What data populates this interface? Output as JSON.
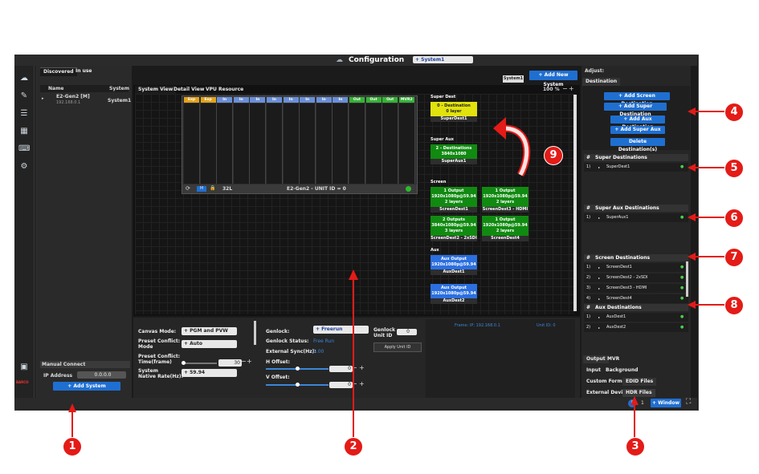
{
  "title": {
    "text": "Configuration",
    "system_select": "+ System1"
  },
  "left_panel": {
    "tabs": [
      "Discovered",
      "In use"
    ],
    "columns": {
      "name": "Name",
      "system": "System"
    },
    "device": {
      "name": "E2-Gen2 [M]",
      "ip": "192.168.0.1",
      "system": "System1"
    },
    "manual_connect": {
      "title": "Manual Connect",
      "ip_label": "IP Address",
      "ip_value": "0.0.0.0",
      "add_button": "+ Add System"
    },
    "brand": "BARCO"
  },
  "center": {
    "tabs": [
      "System View",
      "Detail View",
      "VPU Resource"
    ],
    "system_badge": "System1",
    "add_new_system": "+ Add New System",
    "zoom": "100 %",
    "slot_labels": [
      "Exp",
      "Exp",
      "In",
      "In",
      "In",
      "In",
      "In",
      "In",
      "In",
      "In",
      "Out",
      "Out",
      "Out",
      "MVR2"
    ],
    "frame_footer": {
      "number": "32L",
      "unit": "E2-Gen2 - UNIT ID = 0",
      "m": "M"
    },
    "dest_groups": {
      "super_dest": {
        "title": "Super Dest",
        "items": [
          {
            "line1": "0 - Destination",
            "line2": "0 layer",
            "label": "SuperDest1"
          }
        ]
      },
      "super_aux": {
        "title": "Super Aux",
        "items": [
          {
            "line1": "2 - Destinations",
            "line2": "3840x1080",
            "label": "SuperAux1"
          }
        ]
      },
      "screen": {
        "title": "Screen",
        "items": [
          {
            "line1": "1 Output",
            "line2": "1920x1080p@59.94",
            "line3": "2 layers",
            "label": "ScreenDest1"
          },
          {
            "line1": "1 Output",
            "line2": "1920x1080p@59.94",
            "line3": "2 layers",
            "label": "ScreenDest3 - HDMI"
          },
          {
            "line1": "2 Outputs",
            "line2": "3840x1080p@59.94",
            "line3": "3 layers",
            "label": "ScreenDest2 - 2xSDI"
          },
          {
            "line1": "1 Output",
            "line2": "1920x1080p@59.94",
            "line3": "2 layers",
            "label": "ScreenDest4"
          }
        ]
      },
      "aux": {
        "title": "Aux",
        "items": [
          {
            "line1": "Aux Output",
            "line2": "1920x1080p@59.94",
            "label": "AuxDest1"
          },
          {
            "line1": "Aux Output",
            "line2": "1920x1080p@59.94",
            "label": "AuxDest2"
          }
        ]
      }
    }
  },
  "properties": {
    "canvas_mode": {
      "label": "Canvas Mode:",
      "value": "+ PGM and PVW"
    },
    "preset_conflict_mode": {
      "label1": "Preset Conflict:",
      "label2": "Mode",
      "value": "+ Auto"
    },
    "preset_conflict_time": {
      "label1": "Preset Conflict:",
      "label2": "Time(frame)",
      "value": "30"
    },
    "native_rate": {
      "label1": "System",
      "label2": "Native Rate(Hz):",
      "value": "+ 59.94"
    },
    "genlock": {
      "label": "Genlock:",
      "value": "+ Freerun"
    },
    "genlock_unit": {
      "label1": "Genlock",
      "label2": "Unit ID",
      "value": "0"
    },
    "genlock_status": {
      "label": "Genlock Status:",
      "value": "Free Run"
    },
    "external_sync": {
      "label": "External Sync(Hz):",
      "value": "0.00"
    },
    "apply_unit": "Apply Unit ID",
    "h_offset": {
      "label": "H Offset:",
      "value": "0"
    },
    "v_offset": {
      "label": "V Offset:",
      "value": "0"
    },
    "frame_info": {
      "ip": "Frame: IP: 192.168.0.1",
      "unit": "Unit ID: 0"
    }
  },
  "right_panel": {
    "adjust_label": "Adjust:",
    "destination_tab": "Destination",
    "buttons": [
      "+ Add Screen Destination",
      "+ Add Super Destination",
      "+ Add Aux Destination",
      "+ Add Super Aux",
      "Delete Destination(s)"
    ],
    "super_destinations": {
      "title": "Super Destinations",
      "items": [
        {
          "n": "1)",
          "name": "SuperDest1"
        }
      ]
    },
    "super_aux_destinations": {
      "title": "Super Aux Destinations",
      "items": [
        {
          "n": "1)",
          "name": "SuperAux1"
        }
      ]
    },
    "screen_destinations": {
      "title": "Screen Destinations",
      "items": [
        {
          "n": "1)",
          "name": "ScreenDest1"
        },
        {
          "n": "2)",
          "name": "ScreenDest2 - 2xSDI"
        },
        {
          "n": "3)",
          "name": "ScreenDest3 - HDMI"
        },
        {
          "n": "4)",
          "name": "ScreenDest4"
        }
      ]
    },
    "aux_destinations": {
      "title": "Aux Destinations",
      "items": [
        {
          "n": "1)",
          "name": "AuxDest1"
        },
        {
          "n": "2)",
          "name": "AuxDest2"
        }
      ]
    },
    "bottom_tabs": {
      "row1": [
        "Output",
        "MVR"
      ],
      "row2": [
        "Input",
        "Background"
      ],
      "row3": [
        "Custom Format",
        "EDID Files"
      ],
      "row4": [
        "External Devices",
        "HDR Files"
      ]
    }
  },
  "statusbar": {
    "info_count": "1",
    "window_button": "+ Window"
  },
  "callouts": [
    "1",
    "2",
    "3",
    "4",
    "5",
    "6",
    "7",
    "8",
    "9"
  ],
  "colors": {
    "accent_blue": "#1f6fd1",
    "dest_green": "#118a11",
    "dest_yellow": "#e2e20e",
    "aux_blue": "#2b6fe0",
    "callout_red": "#e41b17"
  }
}
